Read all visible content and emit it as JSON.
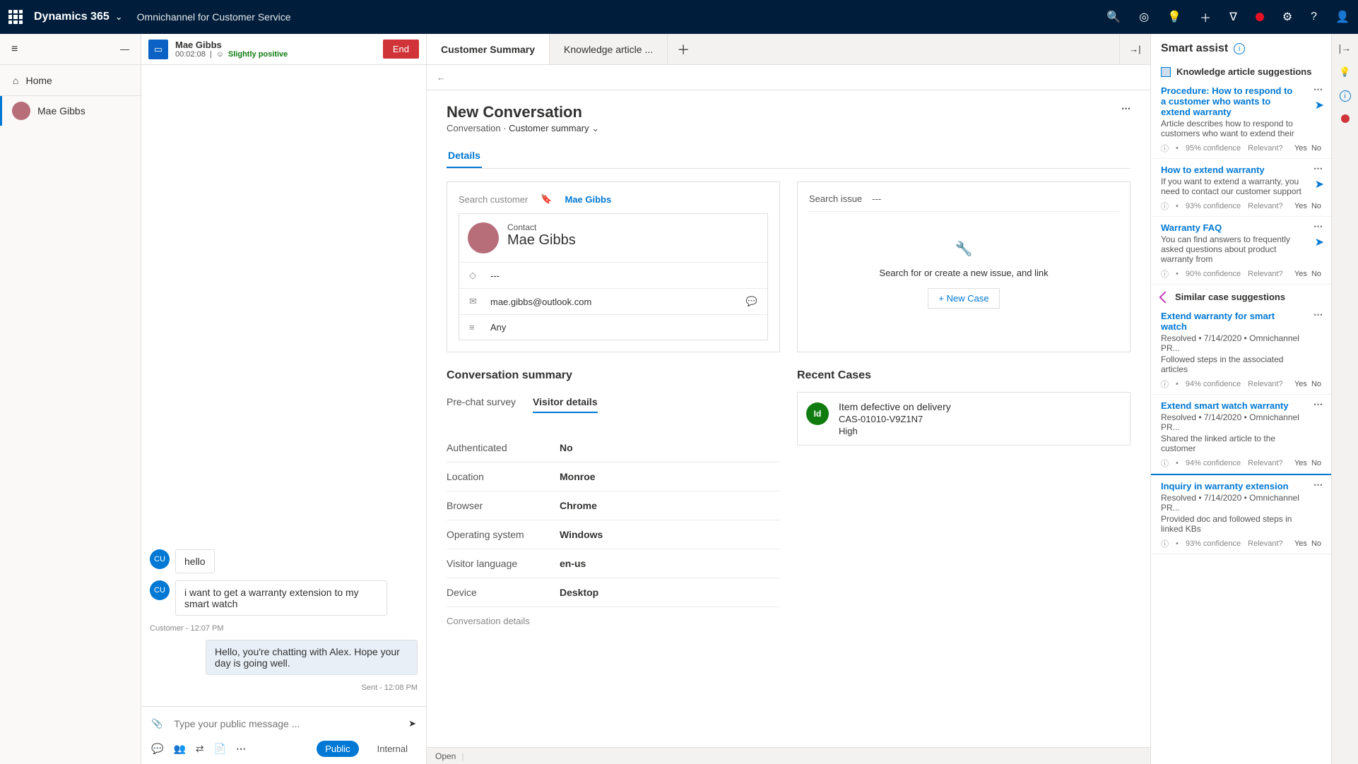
{
  "header": {
    "brand": "Dynamics 365",
    "appName": "Omnichannel for Customer Service"
  },
  "leftRail": {
    "home": "Home",
    "sessionName": "Mae Gibbs"
  },
  "chat": {
    "name": "Mae Gibbs",
    "timer": "00:02:08",
    "sentiment": "Slightly positive",
    "end": "End",
    "messages": [
      {
        "from": "cu",
        "ava": "CU",
        "text": "hello"
      },
      {
        "from": "cu",
        "ava": "CU",
        "text": "i want to get a warranty extension to my smart watch"
      },
      {
        "meta": "Customer - 12:07 PM"
      },
      {
        "from": "agent",
        "text": "Hello, you're chatting with Alex. Hope your day is going well."
      },
      {
        "meta": "Sent - 12:08 PM",
        "right": true
      }
    ],
    "placeholder": "Type your public message ...",
    "public": "Public",
    "internal": "Internal"
  },
  "tabs": {
    "t1": "Customer Summary",
    "t2": "Knowledge article ..."
  },
  "page": {
    "title": "New Conversation",
    "type": "Conversation",
    "sub": "Customer summary",
    "details": "Details"
  },
  "customer": {
    "searchLabel": "Search customer",
    "tag": "Mae Gibbs",
    "contactLabel": "Contact",
    "name": "Mae Gibbs",
    "row1": "---",
    "email": "mae.gibbs@outlook.com",
    "row3": "Any"
  },
  "issue": {
    "label": "Search issue",
    "dash": "---",
    "hint": "Search for or create a new issue, and link",
    "newCase": "+ New Case"
  },
  "convSummary": {
    "title": "Conversation summary",
    "t1": "Pre-chat survey",
    "t2": "Visitor details",
    "rows": [
      {
        "k": "Authenticated",
        "v": "No"
      },
      {
        "k": "Location",
        "v": "Monroe"
      },
      {
        "k": "Browser",
        "v": "Chrome"
      },
      {
        "k": "Operating system",
        "v": "Windows"
      },
      {
        "k": "Visitor language",
        "v": "en-us"
      },
      {
        "k": "Device",
        "v": "Desktop"
      }
    ],
    "more": "Conversation details"
  },
  "recent": {
    "title": "Recent Cases",
    "case": {
      "title": "Item defective on delivery",
      "id": "CAS-01010-V9Z1N7",
      "priority": "High"
    }
  },
  "footer": {
    "open": "Open"
  },
  "smart": {
    "title": "Smart assist",
    "kbLabel": "Knowledge article suggestions",
    "caseLabel": "Similar case suggestions",
    "relevant": "Relevant?",
    "yes": "Yes",
    "no": "No",
    "kb": [
      {
        "t": "Procedure: How to respond to a customer who wants to extend warranty",
        "d": "Article describes how to respond to customers who want to extend their",
        "c": "95% confidence"
      },
      {
        "t": "How to extend warranty",
        "d": "If you want to extend a warranty, you need to contact our customer support",
        "c": "93% confidence"
      },
      {
        "t": "Warranty FAQ",
        "d": "You can find answers to frequently asked questions about product warranty from",
        "c": "90% confidence"
      }
    ],
    "cases": [
      {
        "t": "Extend warranty for smart watch",
        "m": "Resolved • 7/14/2020 • Omnichannel PR...",
        "d": "Followed steps in the associated articles",
        "c": "94% confidence"
      },
      {
        "t": "Extend smart watch warranty",
        "m": "Resolved • 7/14/2020 • Omnichannel PR...",
        "d": "Shared the linked article to the customer",
        "c": "94% confidence"
      },
      {
        "t": "Inquiry in warranty extension",
        "m": "Resolved • 7/14/2020 • Omnichannel PR...",
        "d": "Provided doc and followed steps in linked KBs",
        "c": "93% confidence"
      }
    ]
  }
}
